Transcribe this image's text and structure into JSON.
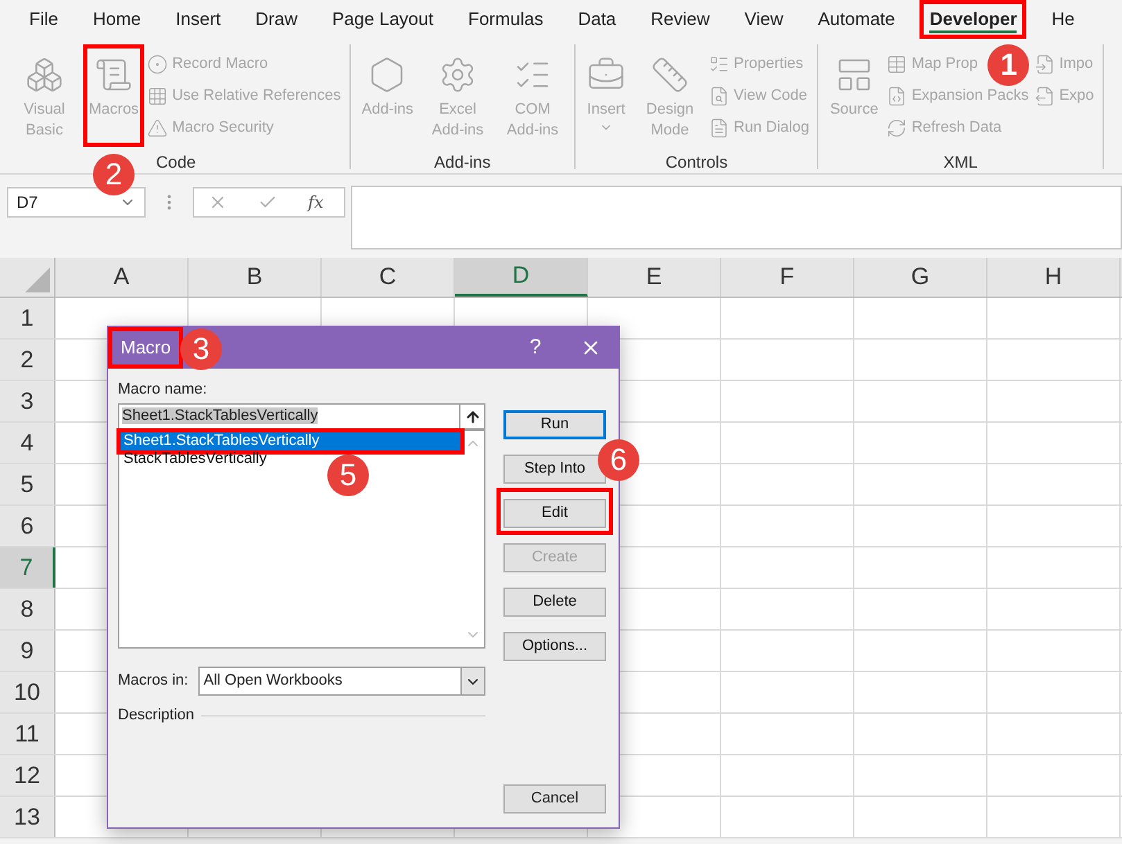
{
  "ribbon_tabs": [
    {
      "label": "File",
      "selected": false,
      "highlighted": false
    },
    {
      "label": "Home",
      "selected": false,
      "highlighted": false
    },
    {
      "label": "Insert",
      "selected": false,
      "highlighted": false
    },
    {
      "label": "Draw",
      "selected": false,
      "highlighted": false
    },
    {
      "label": "Page Layout",
      "selected": false,
      "highlighted": false
    },
    {
      "label": "Formulas",
      "selected": false,
      "highlighted": false
    },
    {
      "label": "Data",
      "selected": false,
      "highlighted": false
    },
    {
      "label": "Review",
      "selected": false,
      "highlighted": false
    },
    {
      "label": "View",
      "selected": false,
      "highlighted": false
    },
    {
      "label": "Automate",
      "selected": false,
      "highlighted": false
    },
    {
      "label": "Developer",
      "selected": true,
      "highlighted": true,
      "callout": "1"
    },
    {
      "label": "He",
      "selected": false,
      "highlighted": false
    }
  ],
  "ribbon_groups": [
    {
      "label": "Code",
      "items": [
        {
          "kind": "large",
          "label": "Visual Basic",
          "disabled": true,
          "highlighted": false
        },
        {
          "kind": "large",
          "label": "Macros",
          "disabled": true,
          "highlighted": true,
          "callout": "2"
        },
        {
          "kind": "small",
          "label": "Record Macro",
          "disabled": true
        },
        {
          "kind": "small",
          "label": "Use Relative References",
          "disabled": true
        },
        {
          "kind": "small",
          "label": "Macro Security",
          "disabled": true
        }
      ]
    },
    {
      "label": "Add-ins",
      "items": [
        {
          "kind": "large",
          "label": "Add-ins",
          "disabled": true,
          "highlighted": false
        },
        {
          "kind": "large",
          "label": "Excel Add-ins",
          "disabled": true,
          "highlighted": false
        },
        {
          "kind": "large",
          "label": "COM Add-ins",
          "disabled": true,
          "highlighted": false
        }
      ]
    },
    {
      "label": "Controls",
      "items": [
        {
          "kind": "large",
          "label": "Insert",
          "disabled": true,
          "highlighted": false,
          "dropdown": true
        },
        {
          "kind": "large",
          "label": "Design Mode",
          "disabled": true,
          "highlighted": false
        },
        {
          "kind": "small",
          "label": "Properties",
          "disabled": true
        },
        {
          "kind": "small",
          "label": "View Code",
          "disabled": true
        },
        {
          "kind": "small",
          "label": "Run Dialog",
          "disabled": true
        }
      ]
    },
    {
      "label": "XML",
      "items": [
        {
          "kind": "large",
          "label": "Source",
          "disabled": true,
          "highlighted": false
        },
        {
          "kind": "small",
          "label": "Map Prop",
          "disabled": true
        },
        {
          "kind": "small",
          "label": "Expansion Packs",
          "disabled": true
        },
        {
          "kind": "small",
          "label": "Refresh Data",
          "disabled": true
        },
        {
          "kind": "small",
          "label": "Impo",
          "disabled": true
        },
        {
          "kind": "small",
          "label": "Expo",
          "disabled": true
        }
      ]
    }
  ],
  "formula_bar": {
    "name_box": "D7",
    "function_label": "fx"
  },
  "sheet": {
    "columns": [
      {
        "label": "A",
        "selected": false
      },
      {
        "label": "B",
        "selected": false
      },
      {
        "label": "C",
        "selected": false
      },
      {
        "label": "D",
        "selected": true
      },
      {
        "label": "E",
        "selected": false
      },
      {
        "label": "F",
        "selected": false
      },
      {
        "label": "G",
        "selected": false
      },
      {
        "label": "H",
        "selected": false
      }
    ],
    "rows": [
      {
        "label": "1",
        "selected": false
      },
      {
        "label": "2",
        "selected": false
      },
      {
        "label": "3",
        "selected": false
      },
      {
        "label": "4",
        "selected": false
      },
      {
        "label": "5",
        "selected": false
      },
      {
        "label": "6",
        "selected": false
      },
      {
        "label": "7",
        "selected": true
      },
      {
        "label": "8",
        "selected": false
      },
      {
        "label": "9",
        "selected": false
      },
      {
        "label": "10",
        "selected": false
      },
      {
        "label": "11",
        "selected": false
      },
      {
        "label": "12",
        "selected": false
      },
      {
        "label": "13",
        "selected": false
      }
    ]
  },
  "dialog": {
    "title": "Macro",
    "title_highlighted": true,
    "title_callout": "3",
    "help": "?",
    "macro_name_label": "Macro name:",
    "macro_name_value": "Sheet1.StackTablesVertically",
    "macros": [
      {
        "label": "Sheet1.StackTablesVertically",
        "selected": true,
        "highlighted": true,
        "callout": "5"
      },
      {
        "label": "StackTablesVertically",
        "selected": false,
        "highlighted": false
      }
    ],
    "buttons": [
      {
        "label": "Run",
        "default": true,
        "disabled": false,
        "highlighted": false
      },
      {
        "label": "Step Into",
        "default": false,
        "disabled": false,
        "highlighted": false,
        "callout": "6"
      },
      {
        "label": "Edit",
        "default": false,
        "disabled": false,
        "highlighted": true
      },
      {
        "label": "Create",
        "default": false,
        "disabled": true,
        "highlighted": false
      },
      {
        "label": "Delete",
        "default": false,
        "disabled": false,
        "highlighted": false
      },
      {
        "label": "Options...",
        "default": false,
        "disabled": false,
        "highlighted": false
      }
    ],
    "macros_in_label": "Macros in:",
    "macros_in_value": "All Open Workbooks",
    "description_label": "Description",
    "cancel_label": "Cancel"
  }
}
